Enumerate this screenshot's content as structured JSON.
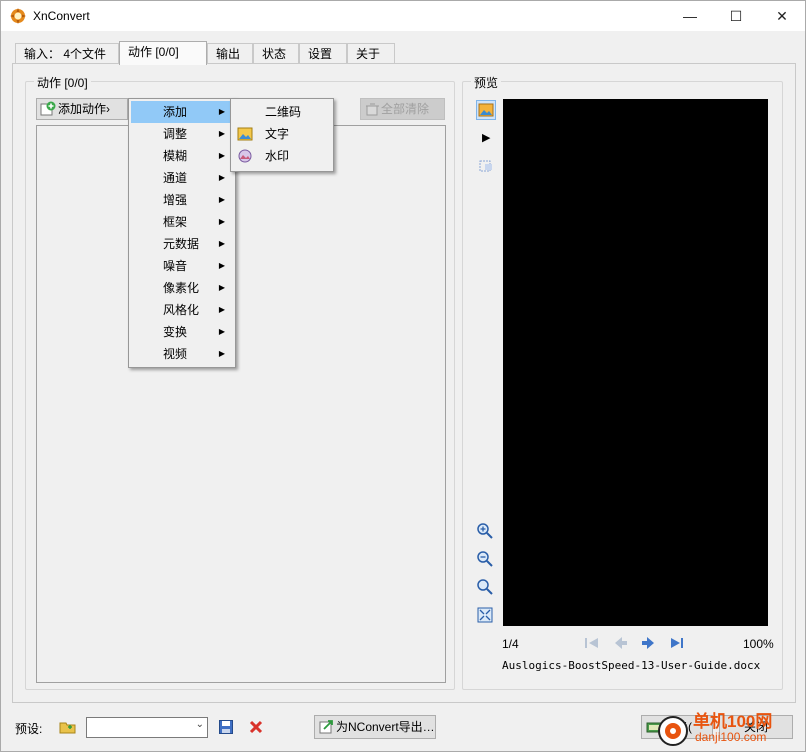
{
  "window": {
    "title": "XnConvert",
    "minimize": "—",
    "maximize": "☐",
    "close": "✕"
  },
  "tabs": [
    {
      "label": "输入： 4个文件"
    },
    {
      "label": "动作 [0/0]"
    },
    {
      "label": "输出"
    },
    {
      "label": "状态"
    },
    {
      "label": "设置"
    },
    {
      "label": "关于"
    }
  ],
  "actions": {
    "group_title": "动作 [0/0]",
    "add_action": "添加动作›",
    "clear_all": "全部清除"
  },
  "menu": {
    "items": [
      "添加",
      "调整",
      "模糊",
      "通道",
      "增强",
      "框架",
      "元数据",
      "噪音",
      "像素化",
      "风格化",
      "变换",
      "视频"
    ],
    "submenu": [
      "二维码",
      "文字",
      "水印"
    ]
  },
  "preview": {
    "group_title": "预览",
    "page": "1/4",
    "zoom": "100%",
    "filename": "Auslogics-BoostSpeed-13-User-Guide.docx"
  },
  "bottom": {
    "preset_label": "预设:",
    "preset_value": "",
    "export_label": "为NConvert导出…",
    "convert_label": "转换(",
    "close_label": "关闭"
  },
  "watermark": {
    "line1": "单机100网",
    "line2": "danji100.com"
  }
}
